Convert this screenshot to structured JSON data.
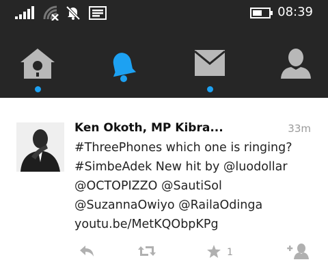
{
  "status_bar": {
    "time": "08:39",
    "icons": [
      "signal-bars-icon",
      "wifi-off-icon",
      "notifications-muted-icon",
      "message-icon",
      "battery-icon"
    ]
  },
  "nav": {
    "tabs": [
      {
        "name": "home",
        "icon": "birdhouse-icon",
        "active": false,
        "has_dot": true
      },
      {
        "name": "notifications",
        "icon": "bell-icon",
        "active": true,
        "has_dot": false
      },
      {
        "name": "messages",
        "icon": "envelope-icon",
        "active": false,
        "has_dot": true
      },
      {
        "name": "profile",
        "icon": "person-icon",
        "active": false,
        "has_dot": false
      }
    ],
    "accent_color": "#1da1f2"
  },
  "tweet": {
    "author": "Ken Okoth, MP Kibra...",
    "time": "33m",
    "lines": [
      "#ThreePhones which one is ringing?",
      "#SimbeAdek New hit by @luodollar",
      "@OCTOPIZZO @SautiSol",
      "@SuzannaOwiyo @RailaOdinga",
      "youtu.be/MetKQObpKPg"
    ],
    "actions": {
      "favorite_count": "1"
    }
  }
}
